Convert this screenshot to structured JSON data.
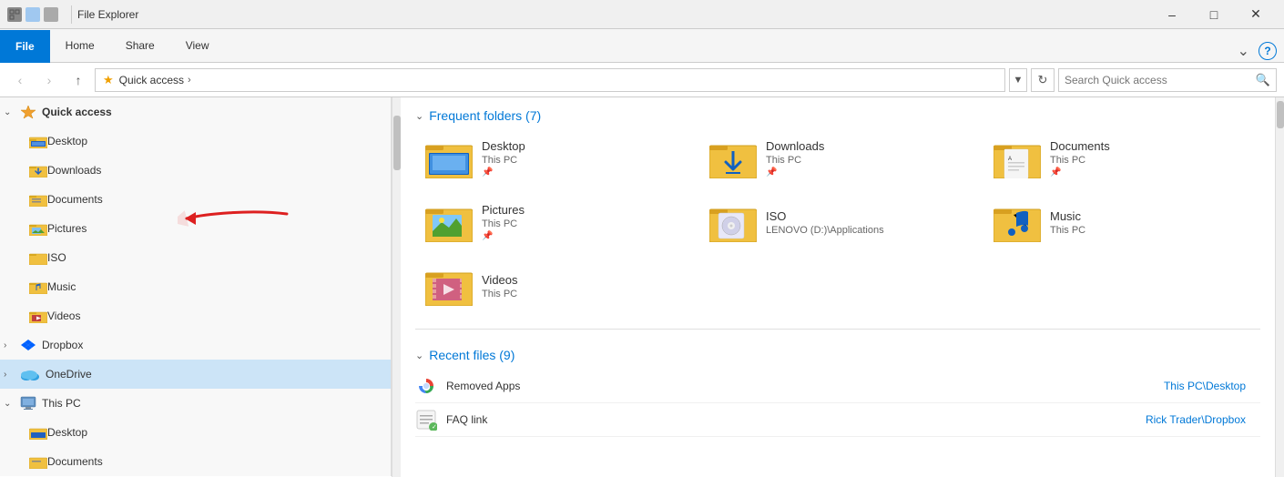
{
  "titleBar": {
    "icons": [
      "square1",
      "square2",
      "square3"
    ],
    "title": "File Explorer",
    "controls": [
      "minimize",
      "maximize",
      "close"
    ]
  },
  "ribbon": {
    "tabs": [
      "File",
      "Home",
      "Share",
      "View"
    ],
    "activeTab": "File",
    "extraButtons": [
      "chevron-down",
      "help"
    ]
  },
  "addressBar": {
    "backButton": "‹",
    "forwardButton": "›",
    "upButton": "↑",
    "starIcon": "★",
    "pathSegments": [
      "Quick access"
    ],
    "pathChevron": "›",
    "dropdownBtn": "▾",
    "refreshBtn": "↺",
    "searchPlaceholder": "Search Quick access",
    "searchIcon": "🔍"
  },
  "sidebar": {
    "quickAccess": {
      "label": "Quick access",
      "expanded": true,
      "items": [
        {
          "label": "Desktop",
          "pinned": true
        },
        {
          "label": "Downloads",
          "pinned": true
        },
        {
          "label": "Documents",
          "pinned": true
        },
        {
          "label": "Pictures",
          "pinned": true
        },
        {
          "label": "ISO",
          "pinned": false
        },
        {
          "label": "Music",
          "pinned": false
        },
        {
          "label": "Videos",
          "pinned": false
        }
      ]
    },
    "dropbox": {
      "label": "Dropbox",
      "expanded": false
    },
    "oneDrive": {
      "label": "OneDrive",
      "expanded": false,
      "selected": true
    },
    "thisPC": {
      "label": "This PC",
      "expanded": true,
      "items": [
        {
          "label": "Desktop"
        },
        {
          "label": "Documents"
        }
      ]
    }
  },
  "content": {
    "frequentFolders": {
      "title": "Frequent folders (7)",
      "folders": [
        {
          "name": "Desktop",
          "path": "This PC",
          "type": "desktop"
        },
        {
          "name": "Downloads",
          "path": "This PC",
          "type": "downloads"
        },
        {
          "name": "Documents",
          "path": "This PC",
          "type": "documents"
        },
        {
          "name": "Pictures",
          "path": "This PC",
          "type": "pictures"
        },
        {
          "name": "ISO",
          "path": "LENOVO (D:)\\Applications",
          "type": "iso"
        },
        {
          "name": "Music",
          "path": "This PC",
          "type": "music"
        },
        {
          "name": "Videos",
          "path": "This PC",
          "type": "videos"
        }
      ]
    },
    "recentFiles": {
      "title": "Recent files (9)",
      "files": [
        {
          "name": "Removed Apps",
          "path": "This PC\\Desktop",
          "icon": "chrome"
        },
        {
          "name": "FAQ link",
          "path": "Rick Trader\\Dropbox",
          "icon": "doc"
        }
      ]
    }
  }
}
